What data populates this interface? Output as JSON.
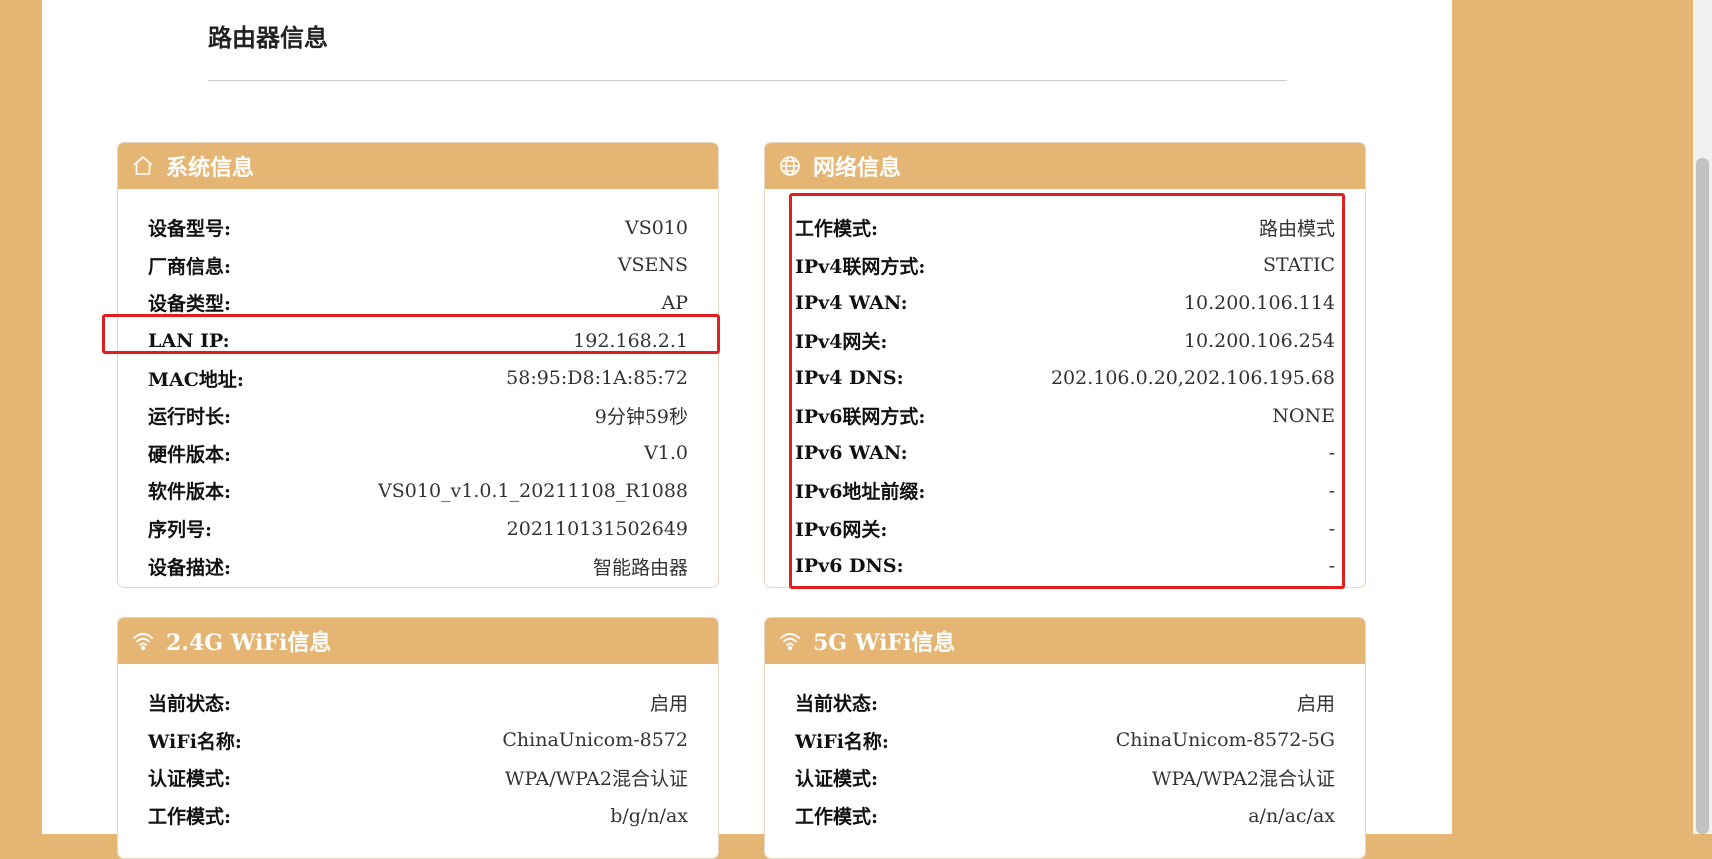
{
  "page": {
    "title": "路由器信息"
  },
  "system_info": {
    "title": "系统信息",
    "icon": "home-icon",
    "rows": [
      {
        "label": "设备型号:",
        "value": "VS010"
      },
      {
        "label": "厂商信息:",
        "value": "VSENS"
      },
      {
        "label": "设备类型:",
        "value": "AP"
      },
      {
        "label": "LAN IP:",
        "value": "192.168.2.1"
      },
      {
        "label": "MAC地址:",
        "value": "58:95:D8:1A:85:72"
      },
      {
        "label": "运行时长:",
        "value": "9分钟59秒"
      },
      {
        "label": "硬件版本:",
        "value": "V1.0"
      },
      {
        "label": "软件版本:",
        "value": "VS010_v1.0.1_20211108_R1088"
      },
      {
        "label": "序列号:",
        "value": "202110131502649"
      },
      {
        "label": "设备描述:",
        "value": "智能路由器"
      }
    ]
  },
  "network_info": {
    "title": "网络信息",
    "icon": "globe-icon",
    "rows": [
      {
        "label": "工作模式:",
        "value": "路由模式"
      },
      {
        "label": "IPv4联网方式:",
        "value": "STATIC"
      },
      {
        "label": "IPv4 WAN:",
        "value": "10.200.106.114"
      },
      {
        "label": "IPv4网关:",
        "value": "10.200.106.254"
      },
      {
        "label": "IPv4 DNS:",
        "value": "202.106.0.20,202.106.195.68"
      },
      {
        "label": "IPv6联网方式:",
        "value": "NONE"
      },
      {
        "label": "IPv6 WAN:",
        "value": "-"
      },
      {
        "label": "IPv6地址前缀:",
        "value": "-"
      },
      {
        "label": "IPv6网关:",
        "value": "-"
      },
      {
        "label": "IPv6 DNS:",
        "value": "-"
      }
    ]
  },
  "wifi_24g": {
    "title": "2.4G WiFi信息",
    "icon": "wifi-icon",
    "rows": [
      {
        "label": "当前状态:",
        "value": "启用"
      },
      {
        "label": "WiFi名称:",
        "value": "ChinaUnicom-8572"
      },
      {
        "label": "认证模式:",
        "value": "WPA/WPA2混合认证"
      },
      {
        "label": "工作模式:",
        "value": "b/g/n/ax"
      }
    ]
  },
  "wifi_5g": {
    "title": "5G WiFi信息",
    "icon": "wifi-icon",
    "rows": [
      {
        "label": "当前状态:",
        "value": "启用"
      },
      {
        "label": "WiFi名称:",
        "value": "ChinaUnicom-8572-5G"
      },
      {
        "label": "认证模式:",
        "value": "WPA/WPA2混合认证"
      },
      {
        "label": "工作模式:",
        "value": "a/n/ac/ax"
      }
    ]
  },
  "colors": {
    "accent": "#e5b673",
    "highlight": "#e41e1e"
  }
}
